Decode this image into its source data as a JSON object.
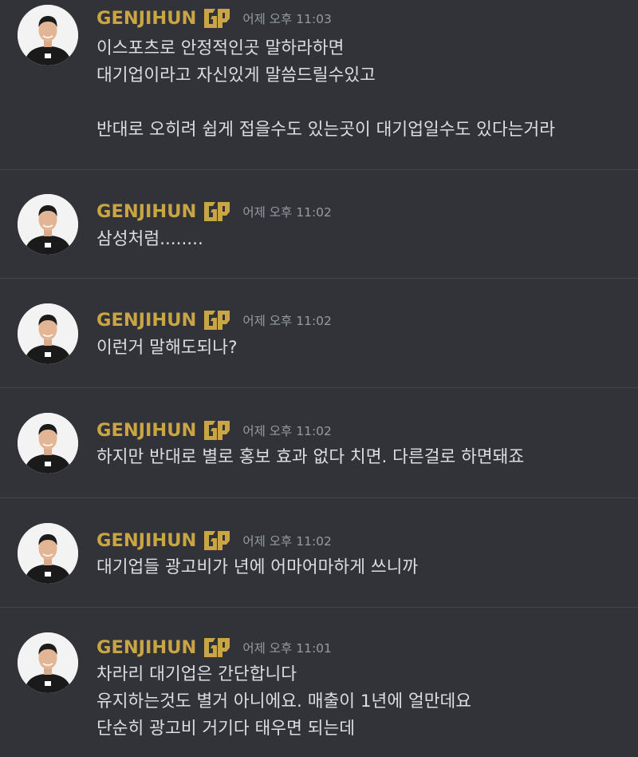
{
  "messages": [
    {
      "username": "GENJIHUN",
      "time": "어제 오후 11:03",
      "lines": [
        "이스포츠로 안정적인곳 말하라하면",
        "대기업이라고 자신있게 말씀드릴수있고",
        "반대로 오히려 쉽게 접을수도 있는곳이 대기업일수도 있다는거라"
      ]
    },
    {
      "username": "GENJIHUN",
      "time": "어제 오후 11:02",
      "lines": [
        "삼성처럼........"
      ]
    },
    {
      "username": "GENJIHUN",
      "time": "어제 오후 11:02",
      "lines": [
        "이런거 말해도되나?"
      ]
    },
    {
      "username": "GENJIHUN",
      "time": "어제 오후 11:02",
      "lines": [
        "하지만 반대로 별로 홍보 효과 없다 치면. 다른걸로 하면돼죠"
      ]
    },
    {
      "username": "GENJIHUN",
      "time": "어제 오후 11:02",
      "lines": [
        "대기업들 광고비가 년에 어마어마하게 쓰니까"
      ]
    },
    {
      "username": "GENJIHUN",
      "time": "어제 오후 11:01",
      "lines": [
        "차라리 대기업은 간단합니다",
        "유지하는것도 별거 아니에요. 매출이 1년에 얼만데요",
        "단순히 광고비 거기다 태우면 되는데"
      ]
    }
  ],
  "badge_icon": "gen-g-team-badge-icon",
  "avatar_icon": "user-avatar-photo",
  "colors": {
    "background": "#313338",
    "username": "#c9a544",
    "timestamp": "#949ba4",
    "text": "#dbdee1",
    "divider": "#43454b"
  }
}
